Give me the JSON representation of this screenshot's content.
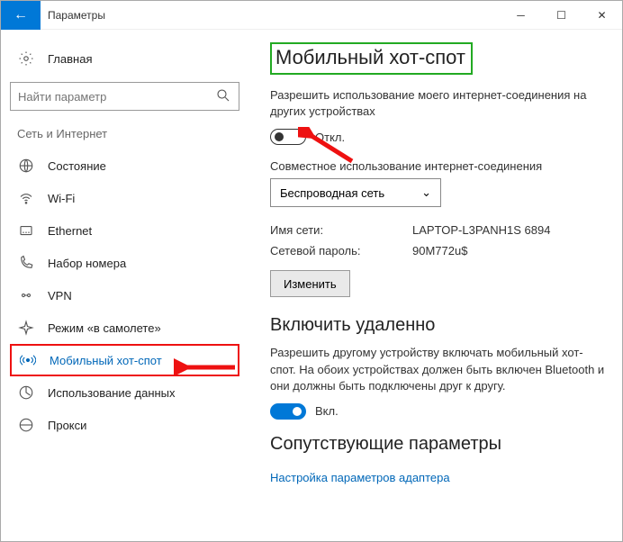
{
  "window": {
    "title": "Параметры"
  },
  "sidebar": {
    "home_label": "Главная",
    "search_placeholder": "Найти параметр",
    "group_label": "Сеть и Интернет",
    "items": [
      {
        "label": "Состояние"
      },
      {
        "label": "Wi-Fi"
      },
      {
        "label": "Ethernet"
      },
      {
        "label": "Набор номера"
      },
      {
        "label": "VPN"
      },
      {
        "label": "Режим «в самолете»"
      },
      {
        "label": "Мобильный хот-спот"
      },
      {
        "label": "Использование данных"
      },
      {
        "label": "Прокси"
      }
    ]
  },
  "main": {
    "title": "Мобильный хот-спот",
    "share_desc": "Разрешить использование моего интернет-соединения на других устройствах",
    "toggle_off_label": "Откл.",
    "share_from_label": "Совместное использование интернет-соединения",
    "share_from_value": "Беспроводная сеть",
    "net_name_label": "Имя сети:",
    "net_name_value": "LAPTOP-L3PANH1S 6894",
    "net_pass_label": "Сетевой пароль:",
    "net_pass_value": "90M772u$",
    "edit_button": "Изменить",
    "remote_title": "Включить удаленно",
    "remote_desc": "Разрешить другому устройству включать мобильный хот-спот. На обоих устройствах должен быть включен Bluetooth и они должны быть подключены друг к другу.",
    "toggle_on_label": "Вкл.",
    "related_title": "Сопутствующие параметры",
    "related_link": "Настройка параметров адаптера"
  }
}
